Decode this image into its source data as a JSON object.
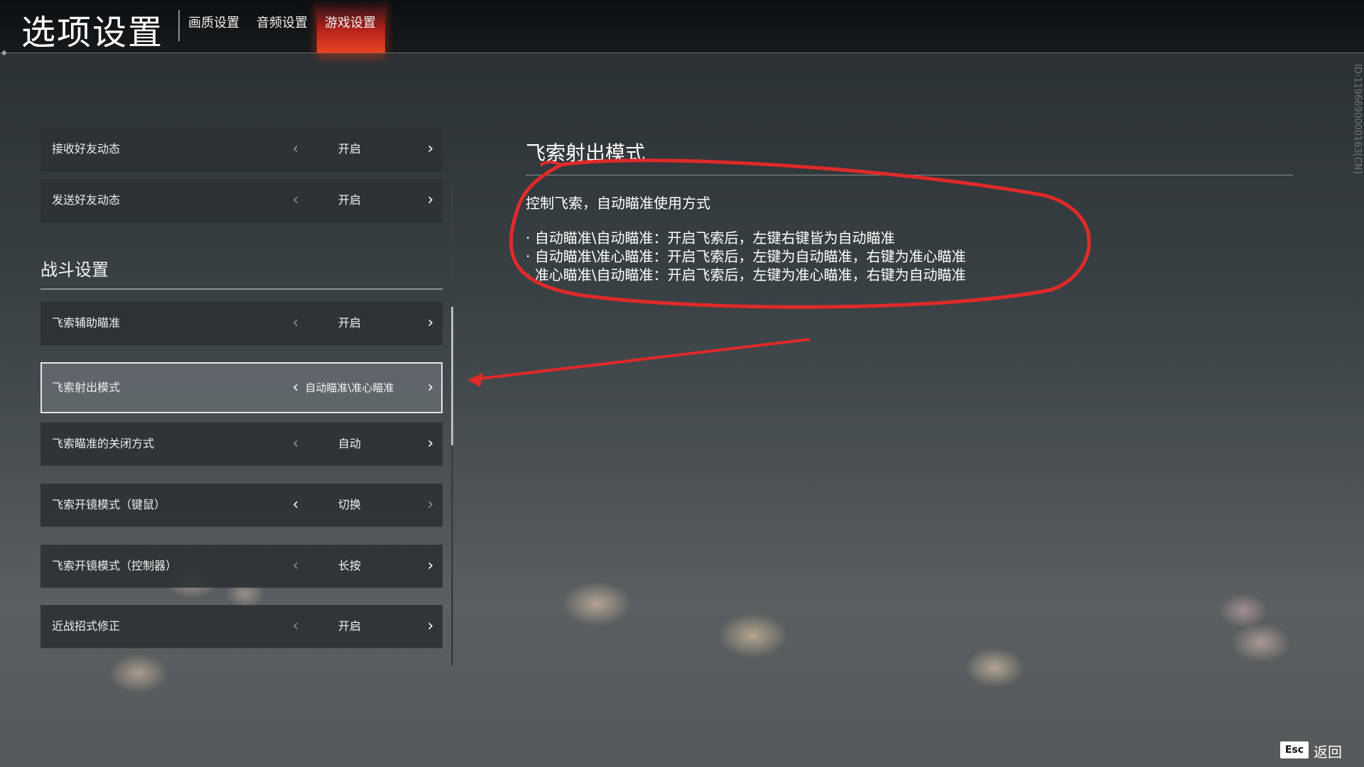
{
  "header": {
    "title": "选项设置",
    "tabs": [
      {
        "label": "画质设置"
      },
      {
        "label": "音频设置"
      },
      {
        "label": "游戏设置",
        "active": true
      }
    ]
  },
  "build_id": "ID:1196690000163[CN]",
  "settings": {
    "rows_top": [
      {
        "label": "接收好友动态",
        "value": "开启"
      },
      {
        "label": "发送好友动态",
        "value": "开启"
      }
    ],
    "section_title": "战斗设置",
    "rows_combat": [
      {
        "label": "飞索辅助瞄准",
        "value": "开启"
      },
      {
        "label": "飞索射出模式",
        "value": "自动瞄准\\准心瞄准",
        "selected": true
      },
      {
        "label": "飞索瞄准的关闭方式",
        "value": "自动"
      },
      {
        "label": "飞索开镜模式（键鼠）",
        "value": "切换"
      },
      {
        "label": "飞索开镜模式（控制器）",
        "value": "长按"
      },
      {
        "label": "近战招式修正",
        "value": "开启"
      }
    ]
  },
  "description": {
    "title": "飞索射出模式",
    "intro": "控制飞索，自动瞄准使用方式",
    "bullets": [
      "· 自动瞄准\\自动瞄准：开启飞索后，左键右键皆为自动瞄准",
      "· 自动瞄准\\准心瞄准：开启飞索后，左键为自动瞄准，右键为准心瞄准",
      "· 准心瞄准\\自动瞄准：开启飞索后，左键为准心瞄准，右键为自动瞄准"
    ]
  },
  "footer": {
    "esc_key": "Esc",
    "back_label": "返回"
  },
  "icons": {
    "arrow_left": "chevron-left-icon",
    "arrow_right": "chevron-right-icon"
  },
  "colors": {
    "active_tab": "#e8441f",
    "annotation": "#e02a2a"
  }
}
